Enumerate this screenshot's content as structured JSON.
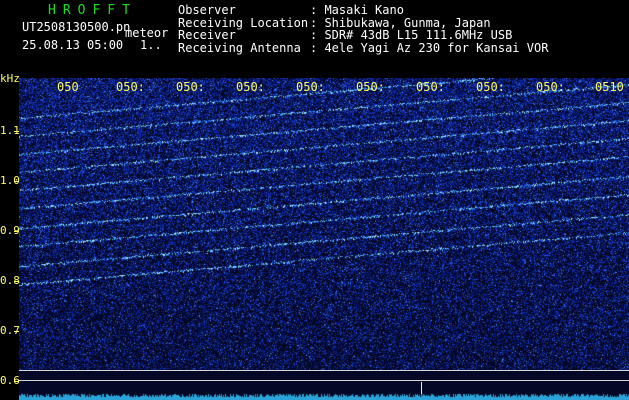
{
  "header": {
    "title": "HROFFT",
    "file": "UT2508130500.pn",
    "mode": "meteor",
    "datetime": "25.08.13 05:00",
    "count": "1.."
  },
  "info": [
    {
      "label": "Observer",
      "value": ": Masaki Kano"
    },
    {
      "label": "Receiving Location",
      "value": ": Shibukawa, Gunma, Japan"
    },
    {
      "label": "Receiver",
      "value": ": SDR# 43dB L15 111.6MHz USB"
    },
    {
      "label": "Receiving Antenna",
      "value": ": 4ele Yagi Az 230 for Kansai VOR"
    }
  ],
  "axes": {
    "y_unit": "kHz",
    "y_ticks": [
      "1.1",
      "1.0",
      "0.9",
      "0.8",
      "0.7",
      "0.6"
    ],
    "x_ticks": [
      "050",
      "050:",
      "050:",
      "050:",
      "050:",
      "050:",
      "050:",
      "050:",
      "050:",
      "0510"
    ]
  },
  "colors": {
    "background": "#000000",
    "spectrogram_base": "#0a1a8c",
    "signal": "#7ad7ff",
    "tick_text": "#ffff66",
    "title": "#18e018"
  }
}
